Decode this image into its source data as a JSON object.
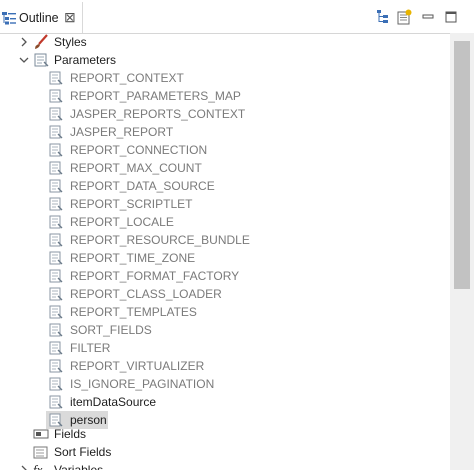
{
  "tab": {
    "title": "Outline",
    "close_glyph": "⊠",
    "icon": "outline-icon"
  },
  "toolbar": {
    "icons": [
      "hierarchy-icon",
      "new-document-icon",
      "minimize-icon",
      "maximize-icon"
    ]
  },
  "tree": {
    "styles": {
      "label": "Styles",
      "icon": "brush-icon",
      "expanded": false
    },
    "parameters": {
      "label": "Parameters",
      "icon": "parameters-icon",
      "expanded": true
    },
    "parameter_items": [
      "REPORT_CONTEXT",
      "REPORT_PARAMETERS_MAP",
      "JASPER_REPORTS_CONTEXT",
      "JASPER_REPORT",
      "REPORT_CONNECTION",
      "REPORT_MAX_COUNT",
      "REPORT_DATA_SOURCE",
      "REPORT_SCRIPTLET",
      "REPORT_LOCALE",
      "REPORT_RESOURCE_BUNDLE",
      "REPORT_TIME_ZONE",
      "REPORT_FORMAT_FACTORY",
      "REPORT_CLASS_LOADER",
      "REPORT_TEMPLATES",
      "SORT_FIELDS",
      "FILTER",
      "REPORT_VIRTUALIZER",
      "IS_IGNORE_PAGINATION",
      "itemDataSource",
      "person"
    ],
    "system_item_count": 18,
    "selected_item": "person",
    "fields": {
      "label": "Fields",
      "icon": "fields-icon"
    },
    "sort_fields": {
      "label": "Sort Fields",
      "icon": "sort-fields-icon"
    },
    "variables": {
      "label": "Variables",
      "icon": "fx-icon",
      "icon_text": "fx"
    }
  },
  "colors": {
    "system_param_text": "#7a7a7a",
    "user_param_text": "#1e1e1e",
    "selection": "#dadada",
    "scrollbar_thumb": "#c2c2c2"
  }
}
